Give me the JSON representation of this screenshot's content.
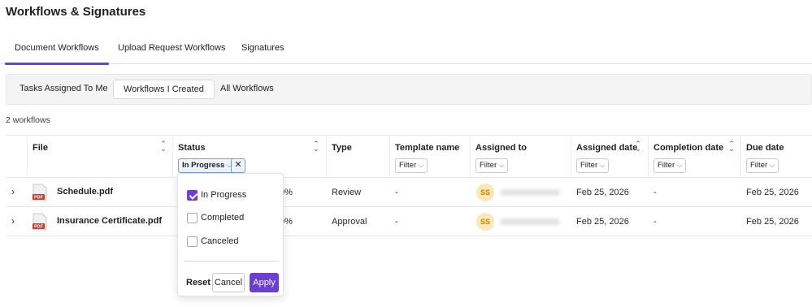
{
  "page": {
    "title": "Workflows & Signatures"
  },
  "tabs": [
    {
      "label": "Document Workflows",
      "active": true
    },
    {
      "label": "Upload Request Workflows",
      "active": false
    },
    {
      "label": "Signatures",
      "active": false
    }
  ],
  "subtabs": [
    {
      "label": "Tasks Assigned To Me",
      "active": false
    },
    {
      "label": "Workflows I Created",
      "active": true
    },
    {
      "label": "All Workflows",
      "active": false
    }
  ],
  "workflow_count": "2 workflows",
  "table": {
    "columns": {
      "file": "File",
      "status": "Status",
      "type": "Type",
      "template_name": "Template name",
      "assigned_to": "Assigned to",
      "assigned_date": "Assigned date",
      "completion_date": "Completion date",
      "due_date": "Due date"
    },
    "filter_label": "Filter",
    "status_filter_value": "In Progress",
    "rows": [
      {
        "file": "Schedule.pdf",
        "icon_label": "PDF",
        "progress": "0%",
        "type": "Review",
        "template": "-",
        "assignee_initials": "SS",
        "assigned_date": "Feb 25, 2026",
        "completion_date": "-",
        "due_date": "Feb 25, 2026"
      },
      {
        "file": "Insurance Certificate.pdf",
        "icon_label": "PDF",
        "progress": "0%",
        "type": "Approval",
        "template": "-",
        "assignee_initials": "SS",
        "assigned_date": "Feb 25, 2026",
        "completion_date": "-",
        "due_date": "Feb 25, 2026"
      }
    ]
  },
  "status_dropdown": {
    "options": [
      {
        "label": "In Progress",
        "checked": true
      },
      {
        "label": "Completed",
        "checked": false
      },
      {
        "label": "Canceled",
        "checked": false
      }
    ],
    "reset_label": "Reset",
    "cancel_label": "Cancel",
    "apply_label": "Apply"
  },
  "colors": {
    "accent": "#6b3fd1",
    "avatar_bg": "#fbe7b8",
    "pdf_red": "#d8352a"
  }
}
